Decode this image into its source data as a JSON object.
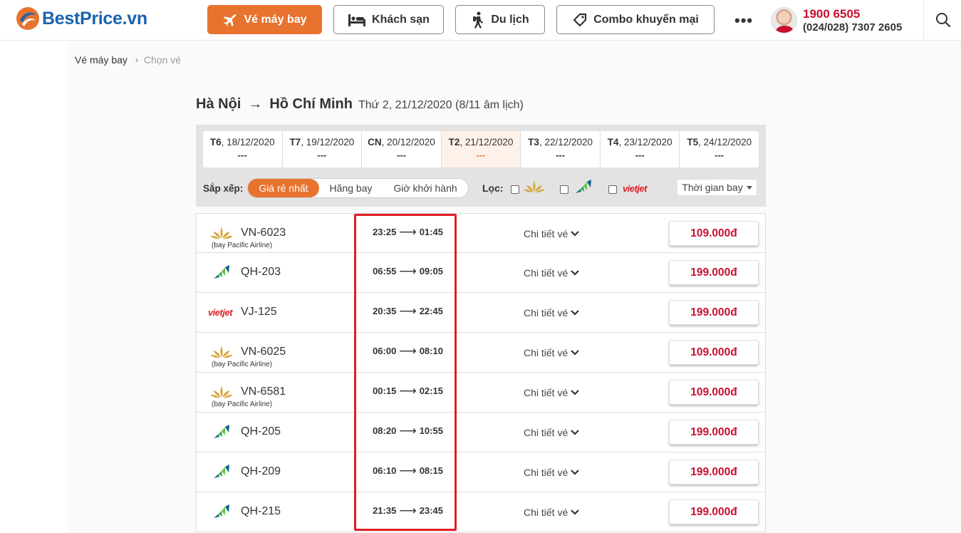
{
  "header": {
    "logo_text": "BestPrice.vn",
    "nav": [
      {
        "label": "Vé máy bay",
        "icon": "plane-icon",
        "active": true
      },
      {
        "label": "Khách sạn",
        "icon": "bed-icon",
        "active": false
      },
      {
        "label": "Du lịch",
        "icon": "hiker-icon",
        "active": false
      },
      {
        "label": "Combo khuyến mại",
        "icon": "tag-icon",
        "active": false
      }
    ],
    "more_label": "•••",
    "hotline_primary": "1900 6505",
    "hotline_secondary": "(024/028) 7307 2605"
  },
  "breadcrumb": {
    "home": "Vé máy bay",
    "separator": "›",
    "current": "Chọn vé"
  },
  "route": {
    "from": "Hà Nội",
    "arrow": "→",
    "to": "Hồ Chí Minh",
    "date": "Thứ 2, 21/12/2020 (8/11 âm lịch)"
  },
  "dates": [
    {
      "day": "T6",
      "date": ", 18/12/2020",
      "price": "---",
      "active": false
    },
    {
      "day": "T7",
      "date": ", 19/12/2020",
      "price": "---",
      "active": false
    },
    {
      "day": "CN",
      "date": ", 20/12/2020",
      "price": "---",
      "active": false
    },
    {
      "day": "T2",
      "date": ", 21/12/2020",
      "price": "---",
      "active": true
    },
    {
      "day": "T3",
      "date": ", 22/12/2020",
      "price": "---",
      "active": false
    },
    {
      "day": "T4",
      "date": ", 23/12/2020",
      "price": "---",
      "active": false
    },
    {
      "day": "T5",
      "date": ", 24/12/2020",
      "price": "---",
      "active": false
    }
  ],
  "sort": {
    "label": "Sắp xếp:",
    "options": [
      "Giá rẻ nhất",
      "Hãng bay",
      "Giờ khởi hành"
    ],
    "active_index": 0
  },
  "filter": {
    "label": "Lọc:",
    "airlines": [
      "Vietnam Airlines",
      "Bamboo Airways",
      "Vietjet"
    ],
    "vietjet_text": "vietjet",
    "duration_label": "Thời gian bay"
  },
  "flights": [
    {
      "airline": "vna",
      "code": "VN-6023",
      "operated": "(bay Pacific Airline)",
      "depart": "23:25",
      "arrive": "01:45",
      "detail": "Chi tiết vé",
      "price": "109.000đ"
    },
    {
      "airline": "bamboo",
      "code": "QH-203",
      "operated": "",
      "depart": "06:55",
      "arrive": "09:05",
      "detail": "Chi tiết vé",
      "price": "199.000đ"
    },
    {
      "airline": "vietjet",
      "code": "VJ-125",
      "operated": "",
      "depart": "20:35",
      "arrive": "22:45",
      "detail": "Chi tiết vé",
      "price": "199.000đ"
    },
    {
      "airline": "vna",
      "code": "VN-6025",
      "operated": "(bay Pacific Airline)",
      "depart": "06:00",
      "arrive": "08:10",
      "detail": "Chi tiết vé",
      "price": "109.000đ"
    },
    {
      "airline": "vna",
      "code": "VN-6581",
      "operated": "(bay Pacific Airline)",
      "depart": "00:15",
      "arrive": "02:15",
      "detail": "Chi tiết vé",
      "price": "109.000đ"
    },
    {
      "airline": "bamboo",
      "code": "QH-205",
      "operated": "",
      "depart": "08:20",
      "arrive": "10:55",
      "detail": "Chi tiết vé",
      "price": "199.000đ"
    },
    {
      "airline": "bamboo",
      "code": "QH-209",
      "operated": "",
      "depart": "06:10",
      "arrive": "08:15",
      "detail": "Chi tiết vé",
      "price": "199.000đ"
    },
    {
      "airline": "bamboo",
      "code": "QH-215",
      "operated": "",
      "depart": "21:35",
      "arrive": "23:45",
      "detail": "Chi tiết vé",
      "price": "199.000đ"
    }
  ],
  "time_arrow": "⟶",
  "colors": {
    "accent": "#e8732f",
    "price": "#c8102e",
    "highlight": "#e01e24",
    "brand": "#1a63b0"
  }
}
